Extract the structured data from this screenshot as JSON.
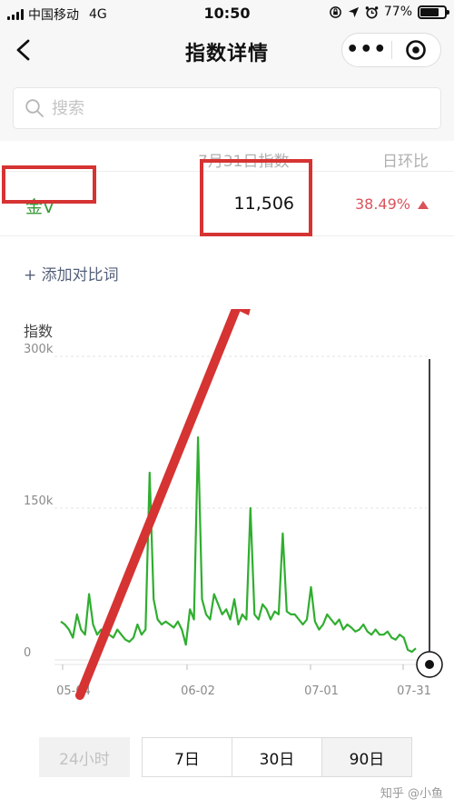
{
  "status_bar": {
    "carrier": "中国移动",
    "network": "4G",
    "time": "10:50",
    "battery": "77%",
    "battery_level": 0.77
  },
  "nav": {
    "title": "指数详情",
    "more_glyph": "•••",
    "back_icon": "chevron-left-icon",
    "close_icon": "target-circle-icon"
  },
  "search": {
    "placeholder": "搜索"
  },
  "table": {
    "col_index": "7月31日指数",
    "col_change": "日环比",
    "term": "金V",
    "value": "11,506",
    "change": "38.49%",
    "change_direction": "up"
  },
  "add_compare": "+ 添加对比词",
  "colors": {
    "accent_green": "#3a9b3a",
    "line_green": "#2fae2f",
    "up_red": "#d9535b",
    "annotation_red": "#d63333"
  },
  "chart_data": {
    "type": "line",
    "ylabel": "指数",
    "y_ticks": [
      "300k",
      "150k",
      "0"
    ],
    "ylim": [
      0,
      300000
    ],
    "x_ticks": [
      "05-04",
      "06-02",
      "07-01",
      "07-31"
    ],
    "x": [
      0,
      1,
      2,
      3,
      4,
      5,
      6,
      7,
      8,
      9,
      10,
      11,
      12,
      13,
      14,
      15,
      16,
      17,
      18,
      19,
      20,
      21,
      22,
      23,
      24,
      25,
      26,
      27,
      28,
      29,
      30,
      31,
      32,
      33,
      34,
      35,
      36,
      37,
      38,
      39,
      40,
      41,
      42,
      43,
      44,
      45,
      46,
      47,
      48,
      49,
      50,
      51,
      52,
      53,
      54,
      55,
      56,
      57,
      58,
      59,
      60,
      61,
      62,
      63,
      64,
      65,
      66,
      67,
      68,
      69,
      70,
      71,
      72,
      73,
      74,
      75,
      76,
      77,
      78,
      79,
      80,
      81,
      82,
      83,
      84,
      85,
      86,
      87,
      88
    ],
    "series": [
      {
        "values": [
          38000,
          35000,
          30000,
          22000,
          45000,
          30000,
          25000,
          65000,
          35000,
          25000,
          30000,
          28000,
          25000,
          22000,
          30000,
          25000,
          20000,
          18000,
          22000,
          35000,
          25000,
          30000,
          185000,
          60000,
          40000,
          35000,
          38000,
          35000,
          32000,
          38000,
          30000,
          15000,
          50000,
          40000,
          220000,
          60000,
          45000,
          40000,
          65000,
          55000,
          45000,
          50000,
          40000,
          60000,
          35000,
          45000,
          40000,
          150000,
          45000,
          40000,
          55000,
          50000,
          40000,
          48000,
          45000,
          125000,
          48000,
          45000,
          45000,
          40000,
          35000,
          40000,
          72000,
          38000,
          30000,
          35000,
          45000,
          40000,
          35000,
          40000,
          30000,
          35000,
          32000,
          28000,
          30000,
          35000,
          28000,
          25000,
          30000,
          25000,
          25000,
          28000,
          22000,
          20000,
          25000,
          22000,
          10000,
          8000,
          11506
        ]
      }
    ]
  },
  "time_tabs": [
    "24小时",
    "7日",
    "30日",
    "90日"
  ],
  "selected_tab": "90日",
  "watermark": "知乎 @小鱼"
}
